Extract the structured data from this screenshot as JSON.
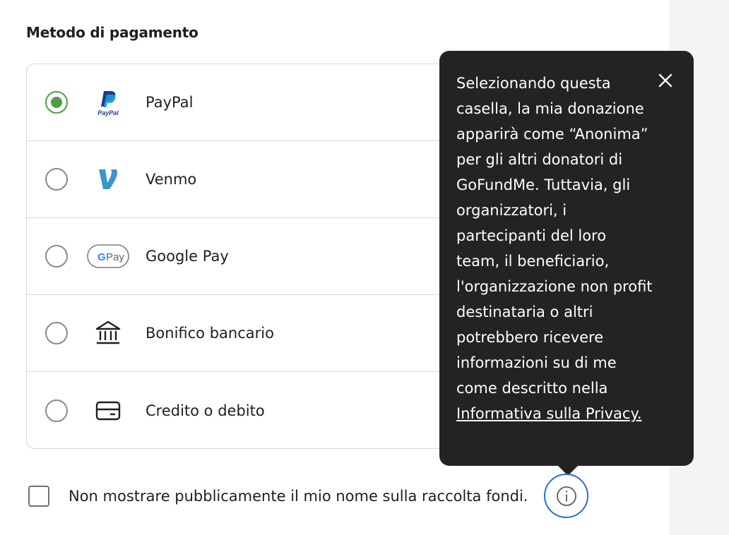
{
  "section_title": "Metodo di pagamento",
  "payment_methods": [
    {
      "label": "PayPal",
      "icon": "paypal-logo-icon",
      "selected": true
    },
    {
      "label": "Venmo",
      "icon": "venmo-logo-icon",
      "selected": false
    },
    {
      "label": "Google Pay",
      "icon": "google-pay-logo-icon",
      "selected": false
    },
    {
      "label": "Bonifico bancario",
      "icon": "bank-icon",
      "selected": false
    },
    {
      "label": "Credito o debito",
      "icon": "credit-card-icon",
      "selected": false
    }
  ],
  "logos": {
    "paypal_text": "PayPal",
    "venmo_text": "V",
    "gpay_g": "G",
    "gpay_text": "Pay"
  },
  "tooltip": {
    "text": "Selezionando questa casella, la mia donazione apparirà come “Anonima” per gli altri donatori di GoFundMe. Tuttavia, gli organizzatori, i partecipanti del loro team, il beneficiario, l'organizzazione non profit destinataria o altri potrebbero ricevere informazioni su di me come descritto nella ",
    "link_text": "Informativa sulla Privacy.",
    "close_icon": "close-icon"
  },
  "anonymous": {
    "label": "Non mostrare pubblicamente il mio nome sulla raccolta fondi.",
    "checked": false,
    "info_icon": "info-icon"
  },
  "colors": {
    "selected_radio": "#4f9d4b",
    "tooltip_bg": "#232323",
    "info_ring": "#2d6ad0",
    "venmo_blue": "#3d95ce",
    "paypal_dark": "#253b80",
    "paypal_light": "#179bd7"
  }
}
